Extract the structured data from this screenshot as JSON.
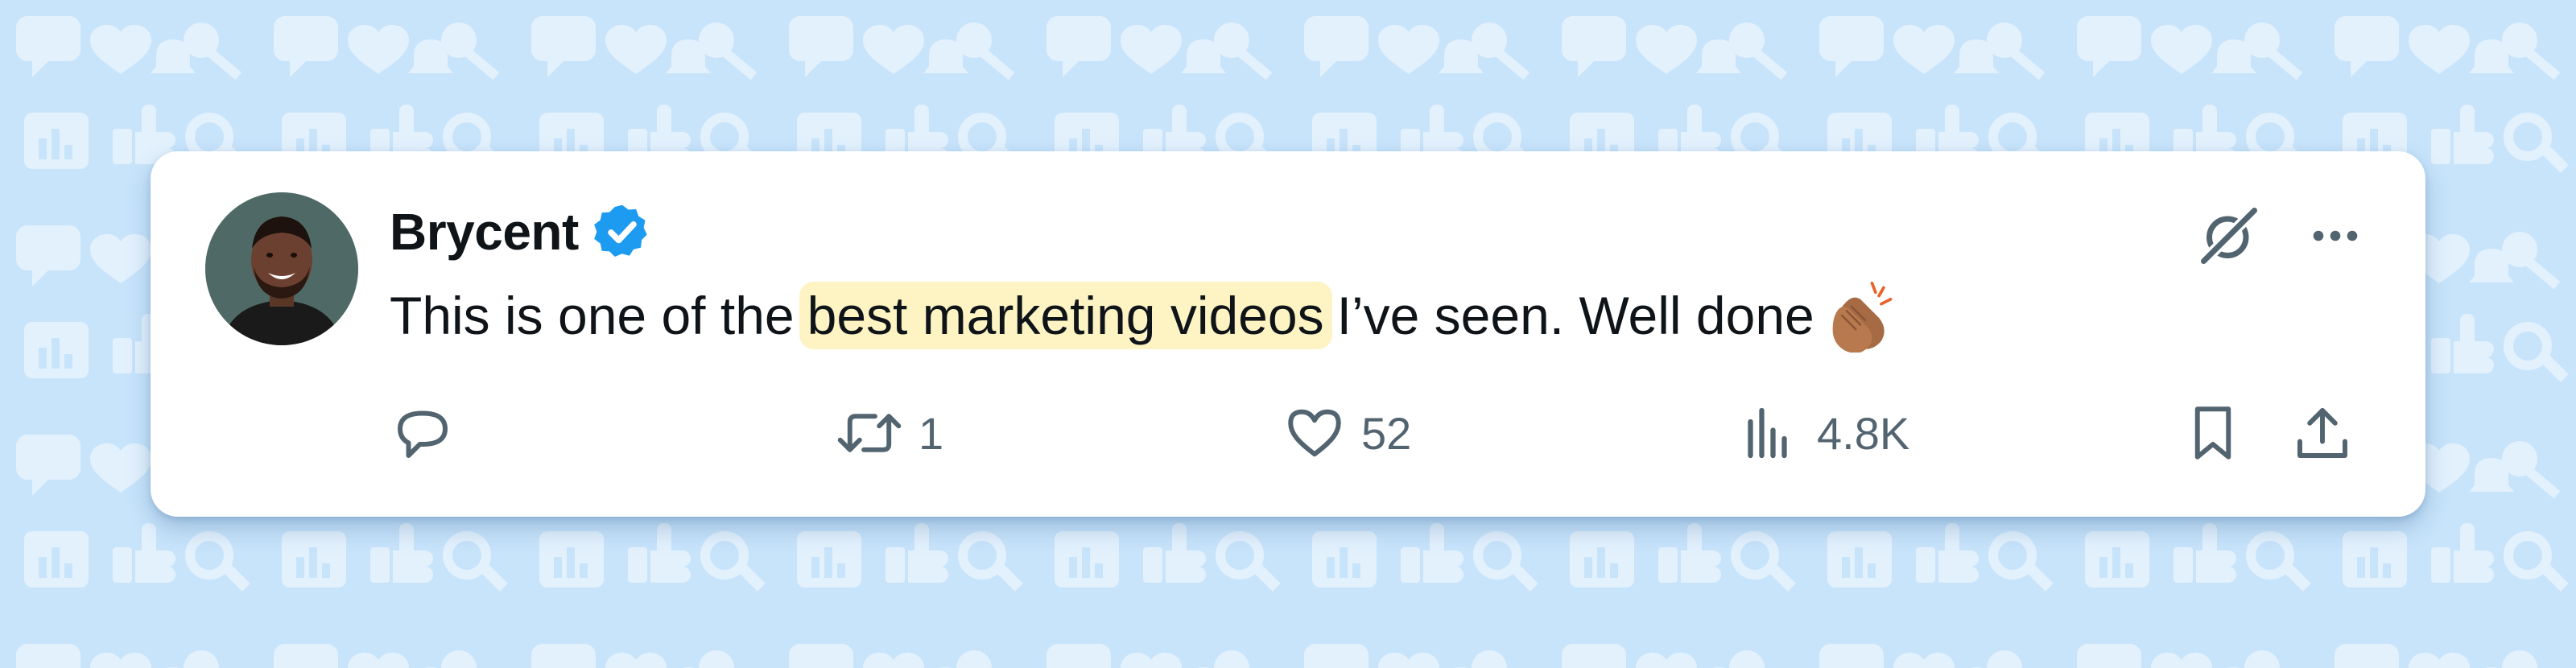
{
  "colors": {
    "background": "#c8e4fb",
    "pattern": "#e3f1fd",
    "verified": "#1d9bf0",
    "highlight": "#fdf3c3",
    "text": "#0f1419",
    "muted": "#536471"
  },
  "author": {
    "name": "Brycent",
    "verified": true,
    "verified_icon": "verified-badge-icon",
    "avatar_icon": "avatar-photo"
  },
  "tweet": {
    "text_before": "This is one of the",
    "text_highlight": "best marketing videos",
    "text_after": "I’ve seen. Well done",
    "emoji_icon": "clapping-hands-emoji"
  },
  "header_icons": {
    "grok": "grok-icon",
    "more": "more-options-icon"
  },
  "actions": {
    "reply": {
      "icon": "reply-icon",
      "count": ""
    },
    "retweet": {
      "icon": "retweet-icon",
      "count": "1"
    },
    "like": {
      "icon": "heart-icon",
      "count": "52"
    },
    "views": {
      "icon": "views-chart-icon",
      "count": "4.8K"
    },
    "bookmark": {
      "icon": "bookmark-icon"
    },
    "share": {
      "icon": "share-icon"
    }
  }
}
